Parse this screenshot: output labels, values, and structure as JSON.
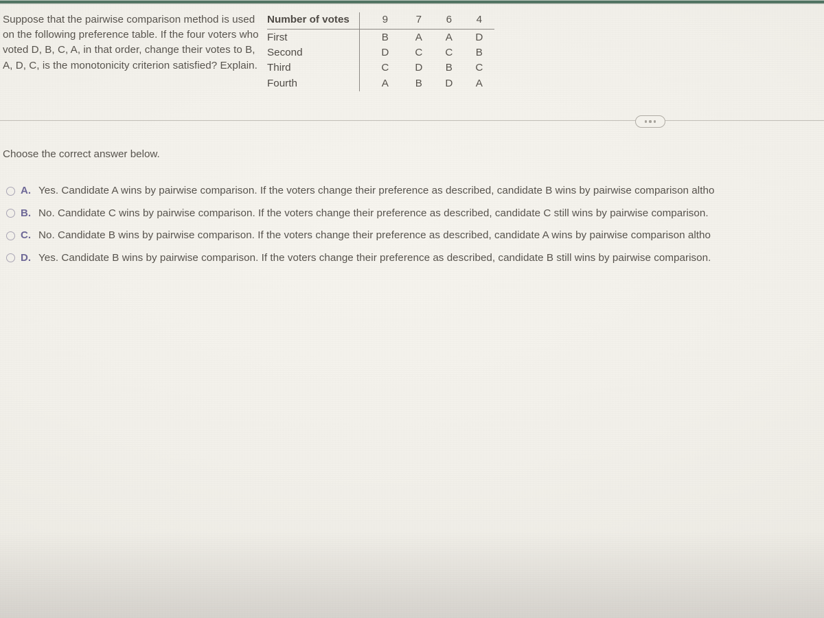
{
  "question": {
    "stem": "Suppose that the pairwise comparison method is used on the following preference table. If the four voters who voted D, B, C, A, in that order, change their votes to B, A, D, C, is the monotonicity criterion satisfied? Explain."
  },
  "preference_table": {
    "header_label": "Number of votes",
    "vote_counts": [
      "9",
      "7",
      "6",
      "4"
    ],
    "rows": [
      {
        "label": "First",
        "values": [
          "B",
          "A",
          "A",
          "D"
        ]
      },
      {
        "label": "Second",
        "values": [
          "D",
          "C",
          "C",
          "B"
        ]
      },
      {
        "label": "Third",
        "values": [
          "C",
          "D",
          "B",
          "C"
        ]
      },
      {
        "label": "Fourth",
        "values": [
          "A",
          "B",
          "D",
          "A"
        ]
      }
    ]
  },
  "toolbar": {
    "expand_label": "•••"
  },
  "answer_section": {
    "prompt": "Choose the correct answer below.",
    "options": [
      {
        "letter": "A.",
        "text": "Yes. Candidate A wins by pairwise comparison. If the voters change their preference as described, candidate B wins by pairwise comparison altho"
      },
      {
        "letter": "B.",
        "text": "No. Candidate C wins by pairwise comparison. If the voters change their preference as described, candidate C still wins by pairwise comparison."
      },
      {
        "letter": "C.",
        "text": "No. Candidate B wins by pairwise comparison. If the voters change their preference as described, candidate A wins by pairwise comparison altho"
      },
      {
        "letter": "D.",
        "text": "Yes. Candidate B wins by pairwise comparison. If the voters change their preference as described, candidate B still wins by pairwise comparison."
      }
    ]
  },
  "colors": {
    "background": "#f2f0ea",
    "text": "#57534d",
    "letter_accent": "#6d6796",
    "top_trim": "#2e5744",
    "rule": "#8d8a85"
  }
}
